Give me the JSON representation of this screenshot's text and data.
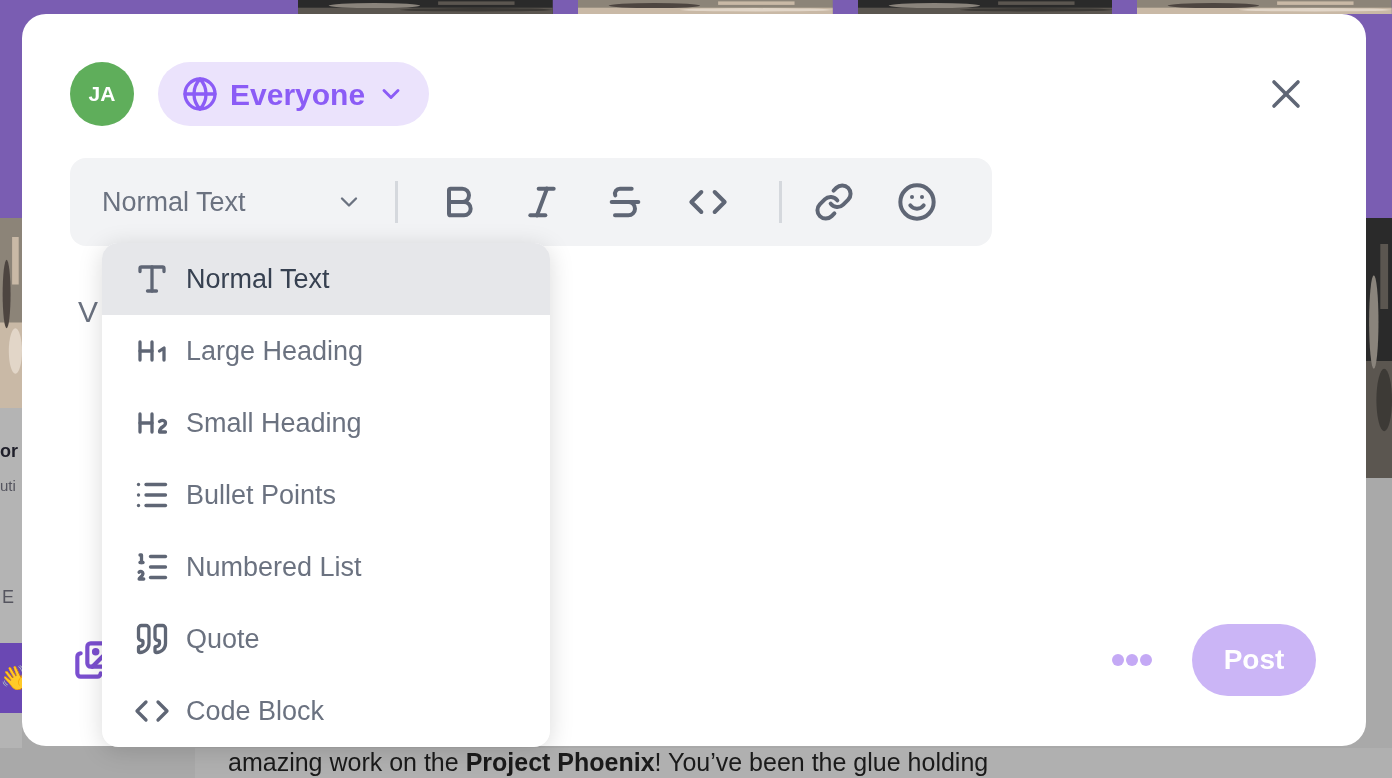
{
  "background": {
    "side_card": {
      "title": "or",
      "subtitle": "uti",
      "meta": "E",
      "banner": "👋"
    },
    "post_text": "amazing work on the **Project Phoenix**! You’ve been the glue holding"
  },
  "composer": {
    "avatar": "JA",
    "audience": "Everyone",
    "placeholder": "V",
    "toolbar": {
      "style_select": "Normal Text",
      "tools": [
        {
          "kind": "bold"
        },
        {
          "kind": "italic"
        },
        {
          "kind": "strike"
        },
        {
          "kind": "code"
        },
        {
          "kind": "divider"
        },
        {
          "kind": "link"
        },
        {
          "kind": "emoji"
        }
      ]
    },
    "style_menu": [
      {
        "label": "Normal Text",
        "kind": "normal",
        "selected": true
      },
      {
        "label": "Large Heading",
        "kind": "h1",
        "selected": false
      },
      {
        "label": "Small Heading",
        "kind": "h2",
        "selected": false
      },
      {
        "label": "Bullet Points",
        "kind": "bullets",
        "selected": false
      },
      {
        "label": "Numbered List",
        "kind": "numbered",
        "selected": false
      },
      {
        "label": "Quote",
        "kind": "quote",
        "selected": false
      },
      {
        "label": "Code Block",
        "kind": "code",
        "selected": false
      }
    ],
    "post_button": {
      "label": "Post",
      "disabled": true
    }
  }
}
